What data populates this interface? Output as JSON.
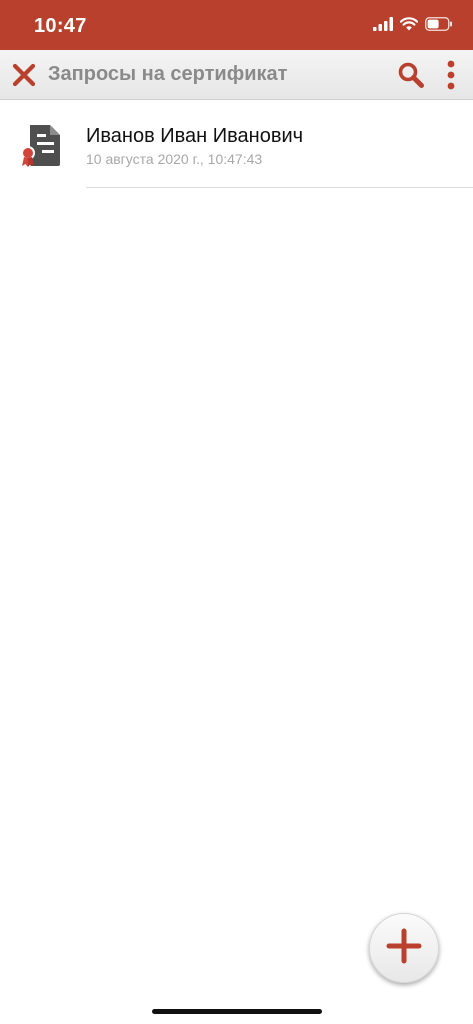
{
  "status_bar": {
    "time": "10:47",
    "icons": [
      "signal-icon",
      "wifi-icon",
      "battery-icon"
    ],
    "color": "#b8402c"
  },
  "toolbar": {
    "title": "Запросы на сертификат",
    "close_icon": "close-icon",
    "search_icon": "search-icon",
    "more_icon": "more-vertical-icon",
    "accent_color": "#b8402c"
  },
  "requests": [
    {
      "name": "Иванов Иван Иванович",
      "date": "10 августа 2020 г., 10:47:43",
      "icon": "certificate-document-icon"
    }
  ],
  "fab": {
    "icon": "plus-icon"
  }
}
